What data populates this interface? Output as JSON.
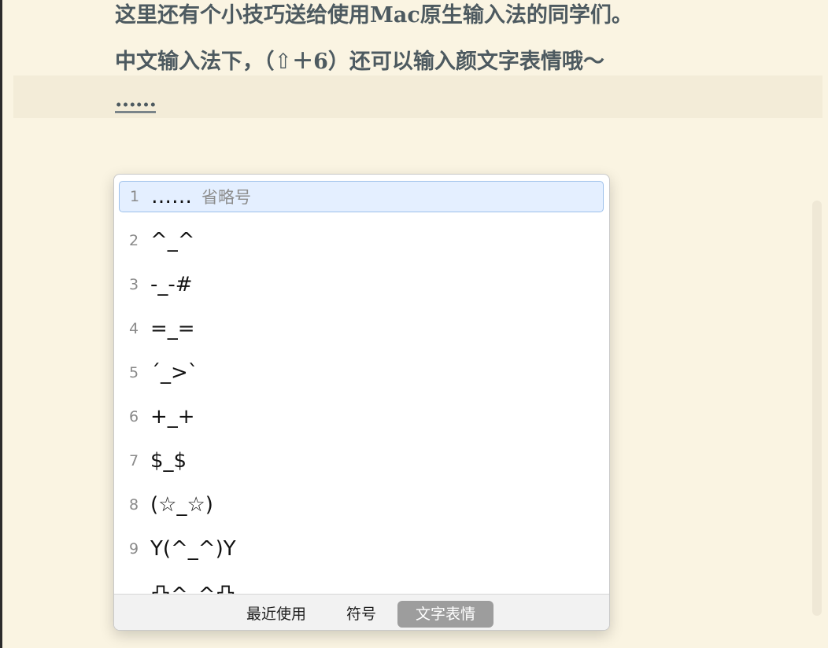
{
  "editor": {
    "line1": "这里还有个小技巧送给使用Mac原生输入法的同学们。",
    "line2": "中文输入法下，（⇧＋6）还可以输入颜文字表情哦～",
    "composing_text": "……"
  },
  "candidate_panel": {
    "candidates": [
      {
        "num": "1",
        "text": "……",
        "hint": "省略号",
        "selected": true
      },
      {
        "num": "2",
        "text": "^_^"
      },
      {
        "num": "3",
        "text": "-_-#"
      },
      {
        "num": "4",
        "text": "=_="
      },
      {
        "num": "5",
        "text": "´_>`"
      },
      {
        "num": "6",
        "text": "+_+"
      },
      {
        "num": "7",
        "text": "$_$"
      },
      {
        "num": "8",
        "text": "(☆_☆)"
      },
      {
        "num": "9",
        "text": "Y(^_^)Y"
      },
      {
        "num": "",
        "text": "凸^_^凸"
      }
    ],
    "tabs": [
      {
        "label": "最近使用",
        "active": false
      },
      {
        "label": "符号",
        "active": false
      },
      {
        "label": "文字表情",
        "active": true
      }
    ]
  },
  "colors": {
    "page_background": "#faf4e2",
    "text": "#4d5a60",
    "selected_candidate": "#e4efff",
    "active_tab": "#9d9d9d"
  }
}
